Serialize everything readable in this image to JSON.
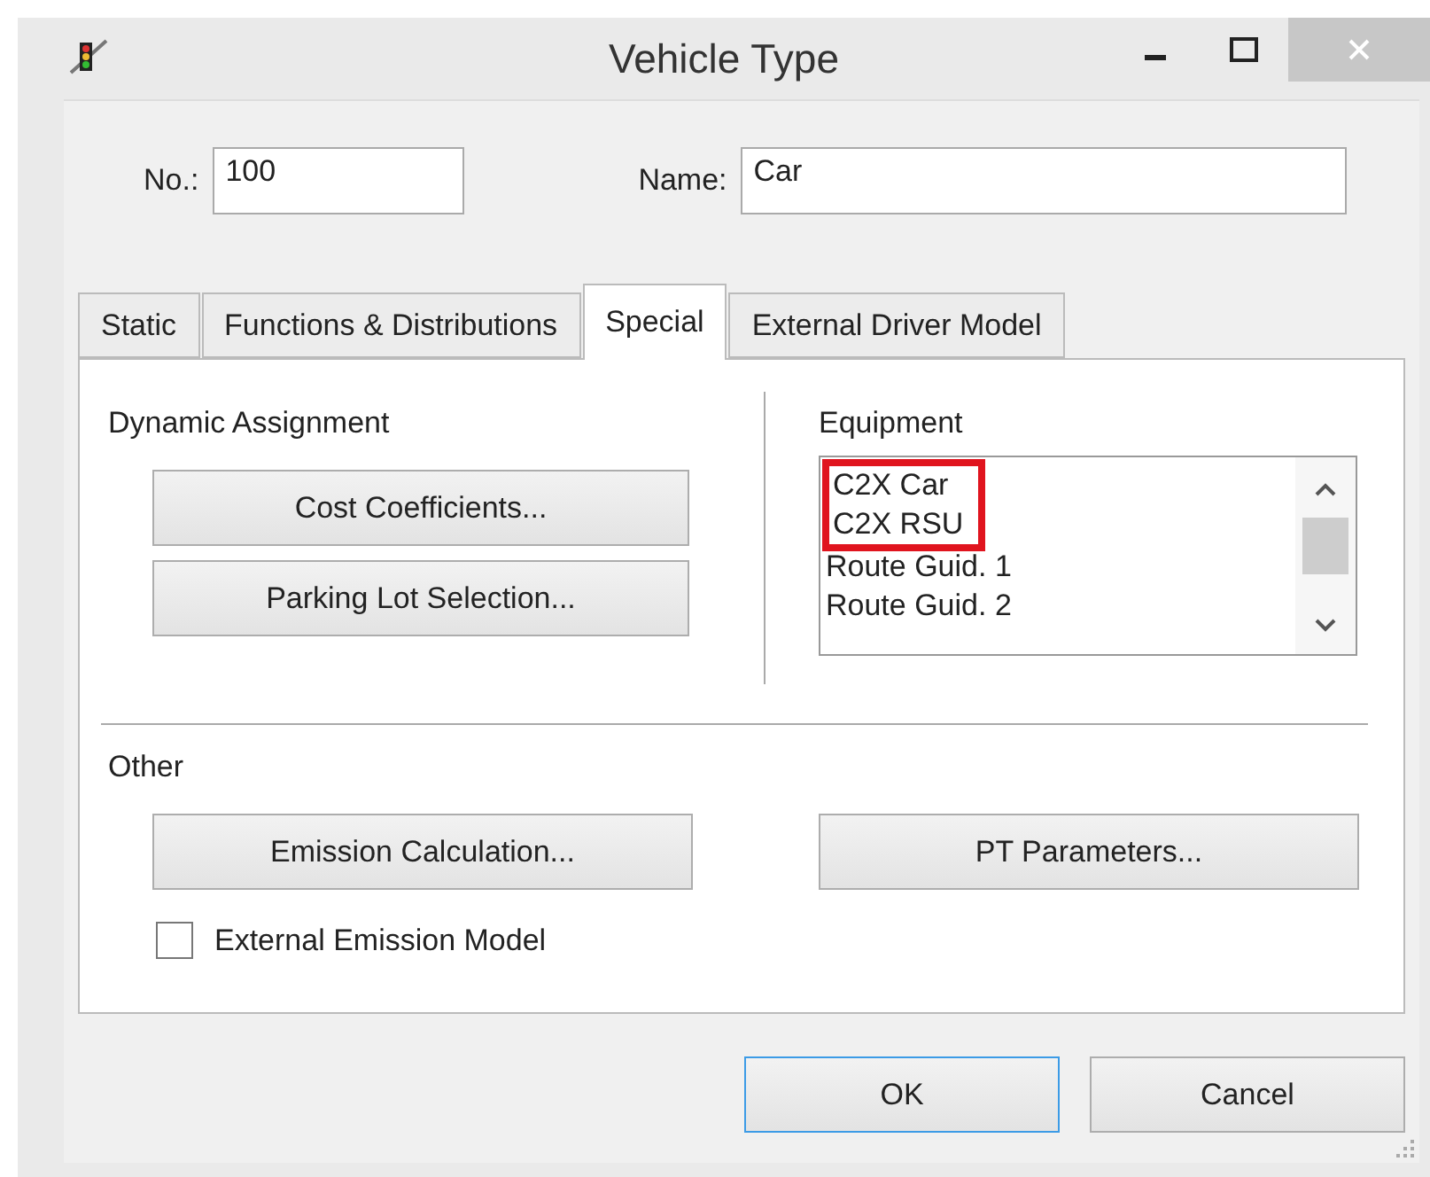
{
  "window": {
    "title": "Vehicle Type"
  },
  "fields": [
    {
      "label": "No.:",
      "value": "100"
    },
    {
      "label": "Name:",
      "value": "Car"
    }
  ],
  "tabs": [
    {
      "label": "Static",
      "selected": false
    },
    {
      "label": "Functions & Distributions",
      "selected": false
    },
    {
      "label": "Special",
      "selected": true
    },
    {
      "label": "External Driver Model",
      "selected": false
    }
  ],
  "dynamic_assignment": {
    "title": "Dynamic Assignment",
    "buttons": [
      "Cost Coefficients...",
      "Parking Lot Selection..."
    ]
  },
  "equipment": {
    "title": "Equipment",
    "items": [
      {
        "label": "C2X Car",
        "highlighted": true
      },
      {
        "label": "C2X RSU",
        "highlighted": true
      },
      {
        "label": "Route Guid. 1",
        "highlighted": false
      },
      {
        "label": "Route Guid. 2",
        "highlighted": false
      }
    ]
  },
  "other": {
    "title": "Other",
    "buttons": [
      "Emission Calculation...",
      "PT Parameters..."
    ],
    "checkbox": {
      "label": "External Emission Model",
      "checked": false
    }
  },
  "buttons": [
    {
      "label": "OK",
      "default": true
    },
    {
      "label": "Cancel",
      "default": false
    }
  ]
}
